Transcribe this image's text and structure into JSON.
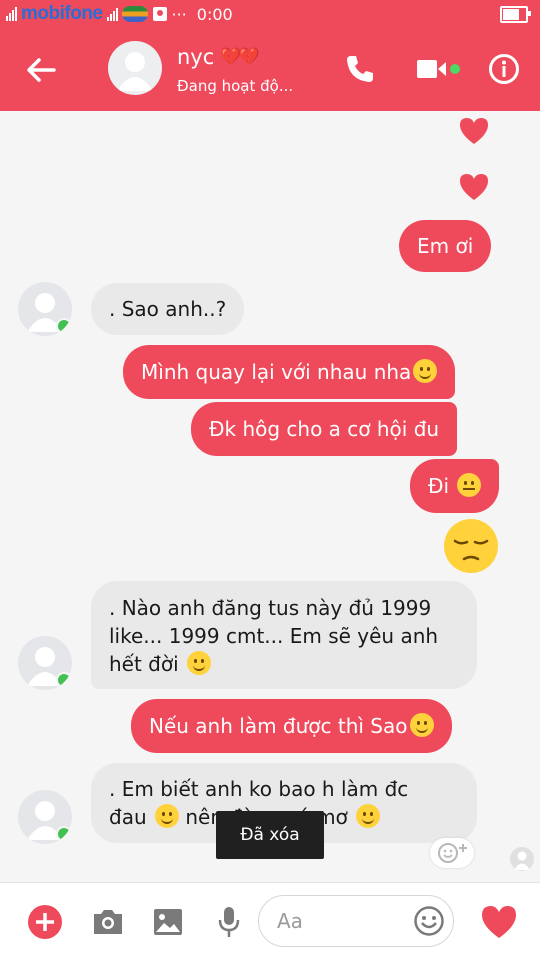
{
  "status_bar": {
    "carrier": "mobifone",
    "time": "0:00"
  },
  "header": {
    "contact_name": "nyc",
    "name_decoration": "💔💔",
    "status": "Đang hoạt độ..."
  },
  "messages": [
    {
      "id": "m1",
      "direction": "out",
      "text": "Em ơi"
    },
    {
      "id": "m2",
      "direction": "in",
      "text": ". Sao anh..?"
    },
    {
      "id": "m3",
      "direction": "out",
      "text": "Mình quay lại với nhau nha"
    },
    {
      "id": "m4",
      "direction": "out",
      "text": "Đk hôg cho a cơ hội đu"
    },
    {
      "id": "m5",
      "direction": "out",
      "text": "Đi"
    },
    {
      "id": "m6",
      "direction": "in",
      "lines": [
        ". Nào anh đăng tus này đủ 1999",
        "like... 1999 cmt... Em sẽ yêu anh",
        "hết đời"
      ]
    },
    {
      "id": "m7",
      "direction": "out",
      "text": "Nếu anh làm được thì Sao"
    },
    {
      "id": "m8",
      "direction": "in",
      "lines": [
        ". Em biết anh ko bao h làm đc",
        "đau",
        "nên đừng có mơ"
      ]
    }
  ],
  "toast": "Đã xóa",
  "composer": {
    "placeholder": "Aa"
  },
  "colors": {
    "accent": "#ef4a5b",
    "incoming_bubble": "#e9e9ea",
    "online": "#42c152"
  }
}
